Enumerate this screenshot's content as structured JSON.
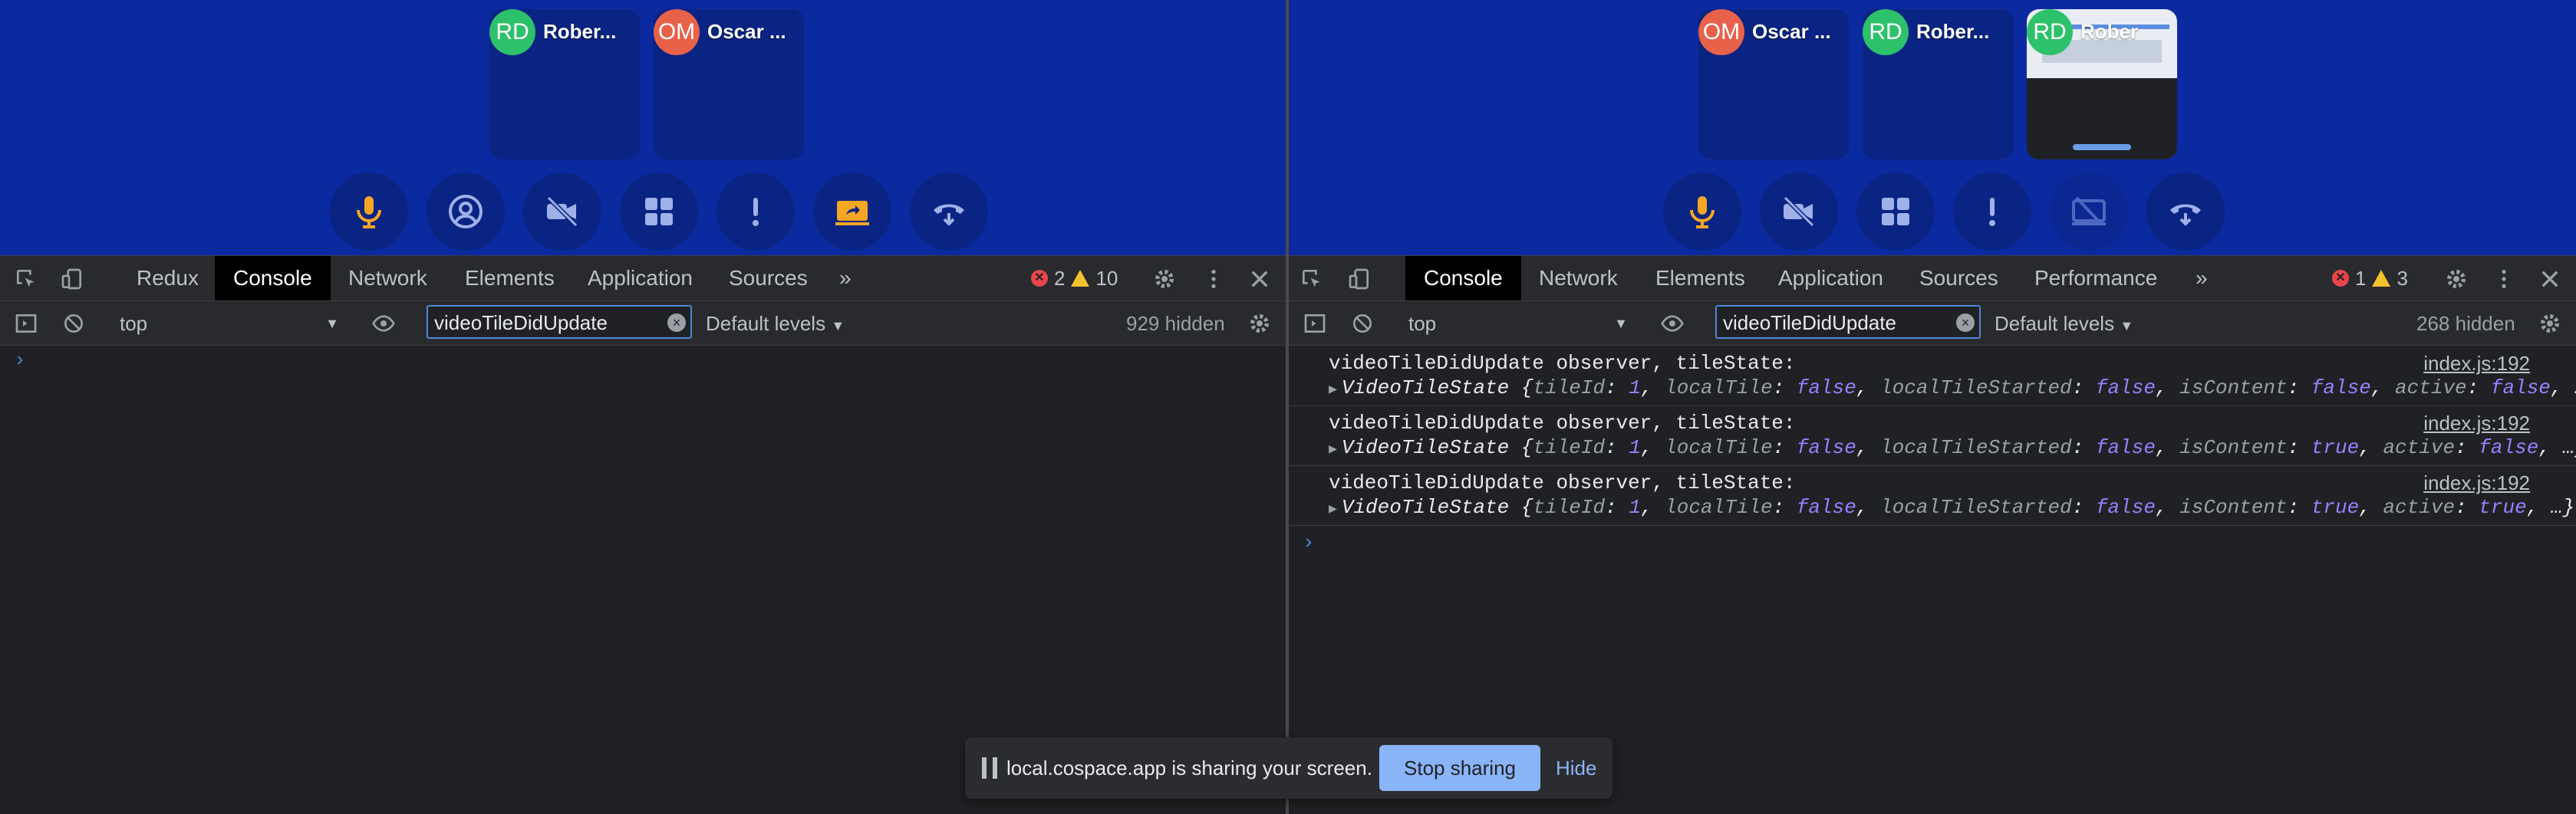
{
  "left": {
    "tiles": [
      {
        "initials": "RD",
        "name": "Rober...",
        "color": "#2ec16b"
      },
      {
        "initials": "OM",
        "name": "Oscar ...",
        "color": "#e8624a"
      }
    ],
    "tabs": [
      "Redux",
      "Console",
      "Network",
      "Elements",
      "Application",
      "Sources"
    ],
    "active_tab": "Console",
    "more_label": "»",
    "errors": "2",
    "warnings": "10",
    "context": "top",
    "filter_value": "videoTileDidUpdate",
    "levels": "Default levels",
    "hidden": "929 hidden",
    "prompt": "›"
  },
  "right": {
    "tiles": [
      {
        "initials": "OM",
        "name": "Oscar ...",
        "color": "#e8624a"
      },
      {
        "initials": "RD",
        "name": "Rober...",
        "color": "#2ec16b"
      },
      {
        "initials": "RD",
        "name": "Rober",
        "color": "#2ec16b"
      }
    ],
    "tabs": [
      "Console",
      "Network",
      "Elements",
      "Application",
      "Sources",
      "Performance"
    ],
    "active_tab": "Console",
    "more_label": "»",
    "errors": "1",
    "warnings": "3",
    "context": "top",
    "filter_value": "videoTileDidUpdate",
    "levels": "Default levels",
    "hidden": "268 hidden",
    "prompt": "›",
    "logs": [
      {
        "message": "videoTileDidUpdate observer, tileState:",
        "source": "index.js:192",
        "object_name": "VideoTileState",
        "tileId": "1",
        "localTile": "false",
        "localTileStarted": "false",
        "isContent": "false",
        "active": "false",
        "ellipsis": "…}"
      },
      {
        "message": "videoTileDidUpdate observer, tileState:",
        "source": "index.js:192",
        "object_name": "VideoTileState",
        "tileId": "1",
        "localTile": "false",
        "localTileStarted": "false",
        "isContent": "true",
        "active": "false",
        "ellipsis": "…}"
      },
      {
        "message": "videoTileDidUpdate observer, tileState:",
        "source": "index.js:192",
        "object_name": "VideoTileState",
        "tileId": "1",
        "localTile": "false",
        "localTileStarted": "false",
        "isContent": "true",
        "active": "true",
        "ellipsis": "…}"
      }
    ]
  },
  "share_bar": {
    "text": "local.cospace.app is sharing your screen.",
    "stop_label": "Stop sharing",
    "hide_label": "Hide"
  },
  "colors": {
    "app_bg": "#0b2aa0",
    "tile_bg": "#0a2483",
    "mic": "#f5a623",
    "share": "#f5a623",
    "accent": "#8ab4f8"
  }
}
